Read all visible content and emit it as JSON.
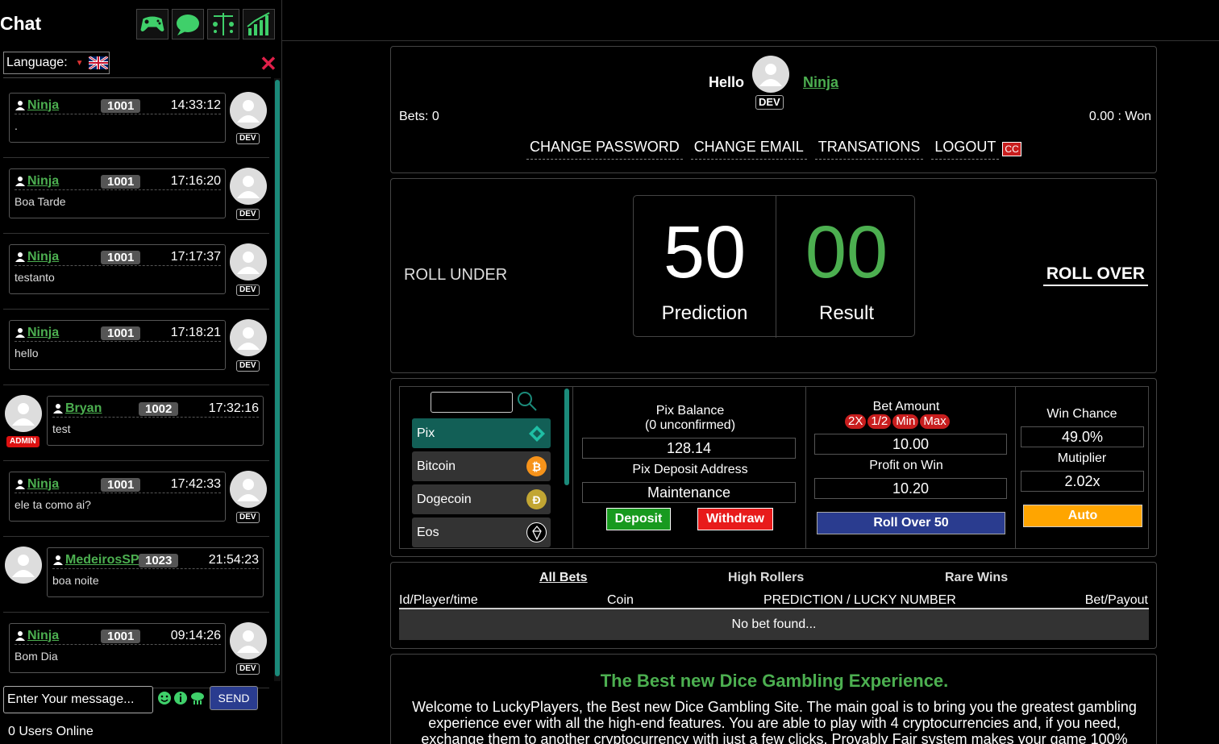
{
  "sidebar": {
    "title": "Chat",
    "top_icons": [
      "gamepad-icon",
      "chat-bubble-icon",
      "balance-scale-icon",
      "stats-chart-icon"
    ],
    "language_label": "Language:",
    "language_flag": "uk-flag-icon",
    "close_icon": "close-icon",
    "messages": [
      {
        "name": "Ninja",
        "level": "1001",
        "time": "14:33:12",
        "text": ".",
        "badge": "DEV",
        "side": "right"
      },
      {
        "name": "Ninja",
        "level": "1001",
        "time": "17:16:20",
        "text": "Boa Tarde",
        "badge": "DEV",
        "side": "right"
      },
      {
        "name": "Ninja",
        "level": "1001",
        "time": "17:17:37",
        "text": "testanto",
        "badge": "DEV",
        "side": "right"
      },
      {
        "name": "Ninja",
        "level": "1001",
        "time": "17:18:21",
        "text": "hello",
        "badge": "DEV",
        "side": "right"
      },
      {
        "name": "Bryan",
        "level": "1002",
        "time": "17:32:16",
        "text": "test",
        "badge": "ADMIN",
        "side": "left"
      },
      {
        "name": "Ninja",
        "level": "1001",
        "time": "17:42:33",
        "text": "ele ta como ai?",
        "badge": "DEV",
        "side": "right"
      },
      {
        "name": "MedeirosSP",
        "level": "1023",
        "time": "21:54:23",
        "text": "boa noite",
        "badge": "",
        "side": "left"
      },
      {
        "name": "Ninja",
        "level": "1001",
        "time": "09:14:26",
        "text": "Bom Dia",
        "badge": "DEV",
        "side": "right"
      }
    ],
    "input_placeholder": "Enter Your message...",
    "send_label": "SEND",
    "users_online": "0 Users Online"
  },
  "account": {
    "hello": "Hello",
    "badge": "DEV",
    "username": "Ninja",
    "bets": "Bets: 0",
    "won": "0.00 : Won",
    "links": [
      "CHANGE PASSWORD",
      "CHANGE EMAIL",
      "TRANSATIONS",
      "LOGOUT"
    ],
    "cc_badge": "CC"
  },
  "dice": {
    "roll_under": "ROLL UNDER",
    "roll_over": "ROLL OVER",
    "prediction_value": "50",
    "prediction_label": "Prediction",
    "result_value": "00",
    "result_label": "Result"
  },
  "coins": [
    {
      "name": "Pix",
      "icon": "pix-icon",
      "color": "#1fbfa5"
    },
    {
      "name": "Bitcoin",
      "icon": "bitcoin-icon",
      "color": "#f7931a"
    },
    {
      "name": "Dogecoin",
      "icon": "dogecoin-icon",
      "color": "#c2a633"
    },
    {
      "name": "Eos",
      "icon": "eos-icon",
      "color": "#000000"
    }
  ],
  "balance": {
    "title_line1": "Pix Balance",
    "title_line2": "(0 unconfirmed)",
    "value": "128.14",
    "deposit_address_label": "Pix Deposit Address",
    "deposit_address": "Maintenance",
    "deposit_btn": "Deposit",
    "withdraw_btn": "Withdraw"
  },
  "bet": {
    "amount_label": "Bet Amount",
    "pills": [
      "2X",
      "1/2",
      "Min",
      "Max"
    ],
    "amount": "10.00",
    "profit_label": "Profit on Win",
    "profit": "10.20",
    "roll_btn": "Roll Over 50"
  },
  "win": {
    "chance_label": "Win Chance",
    "chance": "49.0%",
    "multiplier_label": "Mutiplier",
    "multiplier": "2.02x",
    "auto_btn": "Auto"
  },
  "table": {
    "tabs": [
      "All Bets",
      "High Rollers",
      "Rare Wins"
    ],
    "headers": [
      "Id/Player/time",
      "Coin",
      "PREDICTION / LUCKY NUMBER",
      "Bet/Payout"
    ],
    "empty": "No bet found..."
  },
  "info": {
    "title": "The Best new Dice Gambling Experience.",
    "text": "Welcome to LuckyPlayers, the Best new Dice Gambling Site. The main goal is to bring you the greatest gambling experience ever with all the high-end features. You are able to play with 4 cryptocurrencies and, if you need, exchange them to another cryptocurrency with just a few clicks. Provably Fair system makes your game 100%"
  },
  "colors": {
    "accent_green": "#4caf50",
    "teal": "#125f56",
    "danger": "#c81e1e",
    "primary_blue": "#2a3c8f",
    "orange": "#ffa500"
  }
}
